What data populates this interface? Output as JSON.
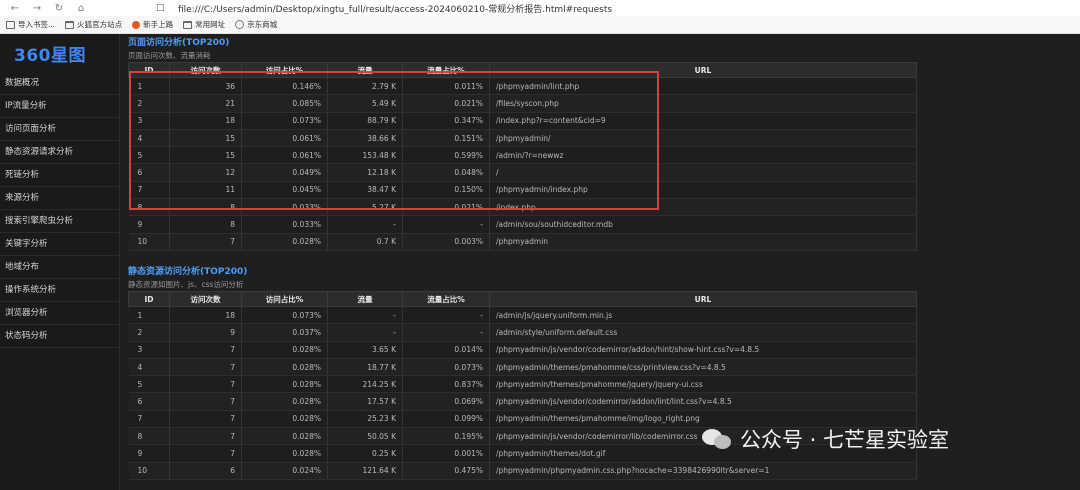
{
  "browser": {
    "url": "file:///C:/Users/admin/Desktop/xingtu_full/result/access-2024060210-常规分析报告.html#requests",
    "bookmarks": [
      {
        "label": "导入书签...",
        "icon": "import-icon"
      },
      {
        "label": "火狐官方站点",
        "icon": "folder-icon"
      },
      {
        "label": "新手上路",
        "icon": "firefox-icon"
      },
      {
        "label": "常用网址",
        "icon": "folder-icon"
      },
      {
        "label": "京东商城",
        "icon": "globe-icon"
      }
    ]
  },
  "sidebar": {
    "logo": "360星图",
    "items": [
      "数据概况",
      "IP流量分析",
      "访问页面分析",
      "静态资源请求分析",
      "死链分析",
      "来源分析",
      "搜索引擎爬虫分析",
      "关键字分析",
      "地域分布",
      "操作系统分析",
      "浏览器分析",
      "状态码分析"
    ]
  },
  "section1": {
    "title": "页面访问分析(TOP200)",
    "subtitle": "页面访问次数、流量消耗",
    "headers": [
      "ID",
      "访问次数",
      "访问占比%",
      "流量",
      "流量占比%",
      "URL"
    ],
    "rows": [
      [
        "1",
        "36",
        "0.146%",
        "2.79 K",
        "0.011%",
        "/phpmyadmin/lint.php"
      ],
      [
        "2",
        "21",
        "0.085%",
        "5.49 K",
        "0.021%",
        "/files/syscon.php"
      ],
      [
        "3",
        "18",
        "0.073%",
        "88.79 K",
        "0.347%",
        "/index.php?r=content&cid=9"
      ],
      [
        "4",
        "15",
        "0.061%",
        "38.66 K",
        "0.151%",
        "/phpmyadmin/"
      ],
      [
        "5",
        "15",
        "0.061%",
        "153.48 K",
        "0.599%",
        "/admin/?r=newwz"
      ],
      [
        "6",
        "12",
        "0.049%",
        "12.18 K",
        "0.048%",
        "/"
      ],
      [
        "7",
        "11",
        "0.045%",
        "38.47 K",
        "0.150%",
        "/phpmyadmin/index.php"
      ],
      [
        "8",
        "8",
        "0.033%",
        "5.27 K",
        "0.021%",
        "/index.php"
      ],
      [
        "9",
        "8",
        "0.033%",
        "-",
        "-",
        "/admin/sou/southidceditor.mdb"
      ],
      [
        "10",
        "7",
        "0.028%",
        "0.7 K",
        "0.003%",
        "/phpmyadmin"
      ]
    ]
  },
  "section2": {
    "title": "静态资源访问分析(TOP200)",
    "subtitle": "静态资源如图片、js、css访问分析",
    "headers": [
      "ID",
      "访问次数",
      "访问占比%",
      "流量",
      "流量占比%",
      "URL"
    ],
    "rows": [
      [
        "1",
        "18",
        "0.073%",
        "-",
        "-",
        "/admin/js/jquery.uniform.min.js"
      ],
      [
        "2",
        "9",
        "0.037%",
        "-",
        "-",
        "/admin/style/uniform.default.css"
      ],
      [
        "3",
        "7",
        "0.028%",
        "3.65 K",
        "0.014%",
        "/phpmyadmin/js/vendor/codemirror/addon/hint/show-hint.css?v=4.8.5"
      ],
      [
        "4",
        "7",
        "0.028%",
        "18.77 K",
        "0.073%",
        "/phpmyadmin/themes/pmahomme/css/printview.css?v=4.8.5"
      ],
      [
        "5",
        "7",
        "0.028%",
        "214.25 K",
        "0.837%",
        "/phpmyadmin/themes/pmahomme/jquery/jquery-ui.css"
      ],
      [
        "6",
        "7",
        "0.028%",
        "17.57 K",
        "0.069%",
        "/phpmyadmin/js/vendor/codemirror/addon/lint/lint.css?v=4.8.5"
      ],
      [
        "7",
        "7",
        "0.028%",
        "25.23 K",
        "0.099%",
        "/phpmyadmin/themes/pmahomme/img/logo_right.png"
      ],
      [
        "8",
        "7",
        "0.028%",
        "50.05 K",
        "0.195%",
        "/phpmyadmin/js/vendor/codemirror/lib/codemirror.css"
      ],
      [
        "9",
        "7",
        "0.028%",
        "0.25 K",
        "0.001%",
        "/phpmyadmin/themes/dot.gif"
      ],
      [
        "10",
        "6",
        "0.024%",
        "121.64 K",
        "0.475%",
        "/phpmyadmin/phpmyadmin.css.php?nocache=3398426990ltr&server=1"
      ]
    ]
  },
  "watermark": "公众号 · 七芒星实验室",
  "colors": {
    "accent": "#4e9cf4",
    "logo": "#3f86f2",
    "highlight": "#e33a3a"
  }
}
